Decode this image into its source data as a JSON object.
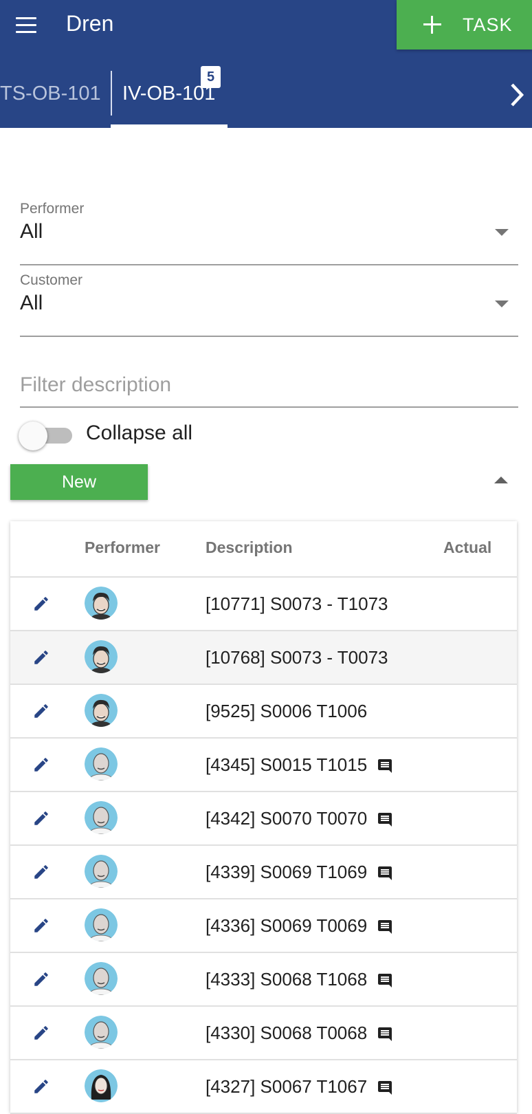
{
  "app_bar": {
    "title": "Dren",
    "task_button_label": "TASK",
    "icons": {
      "menu": "menu-icon",
      "add": "plus-icon",
      "next": "chevron-right-icon"
    },
    "colors": {
      "bar": "#284586",
      "task_button": "#4caf50"
    }
  },
  "tabs": [
    {
      "label": "TS-OB-101",
      "active": false
    },
    {
      "label": "IV-OB-101",
      "active": true,
      "badge": "5"
    }
  ],
  "filters": {
    "performer": {
      "label": "Performer",
      "value": "All"
    },
    "customer": {
      "label": "Customer",
      "value": "All"
    },
    "description": {
      "placeholder": "Filter description",
      "value": ""
    },
    "collapse_all": {
      "label": "Collapse all",
      "on": false
    }
  },
  "group": {
    "label": "New",
    "expanded": true
  },
  "table": {
    "columns": [
      "",
      "Performer",
      "Description",
      "Actual"
    ],
    "rows": [
      {
        "description": "[10771] S0073 - T1073",
        "has_comment": false,
        "avatar": "man-short-hair"
      },
      {
        "description": "[10768] S0073 - T0073",
        "has_comment": false,
        "avatar": "man-short-hair",
        "highlighted": true
      },
      {
        "description": "[9525] S0006 T1006",
        "has_comment": false,
        "avatar": "man-short-hair"
      },
      {
        "description": "[4345] S0015 T1015",
        "has_comment": true,
        "avatar": "man-bald"
      },
      {
        "description": "[4342] S0070 T0070",
        "has_comment": true,
        "avatar": "man-bald"
      },
      {
        "description": "[4339] S0069 T1069",
        "has_comment": true,
        "avatar": "man-bald"
      },
      {
        "description": "[4336] S0069 T0069",
        "has_comment": true,
        "avatar": "man-bald"
      },
      {
        "description": "[4333] S0068 T1068",
        "has_comment": true,
        "avatar": "man-bald"
      },
      {
        "description": "[4330] S0068 T0068",
        "has_comment": true,
        "avatar": "man-bald"
      },
      {
        "description": "[4327] S0067 T1067",
        "has_comment": true,
        "avatar": "woman-long-hair"
      }
    ]
  }
}
